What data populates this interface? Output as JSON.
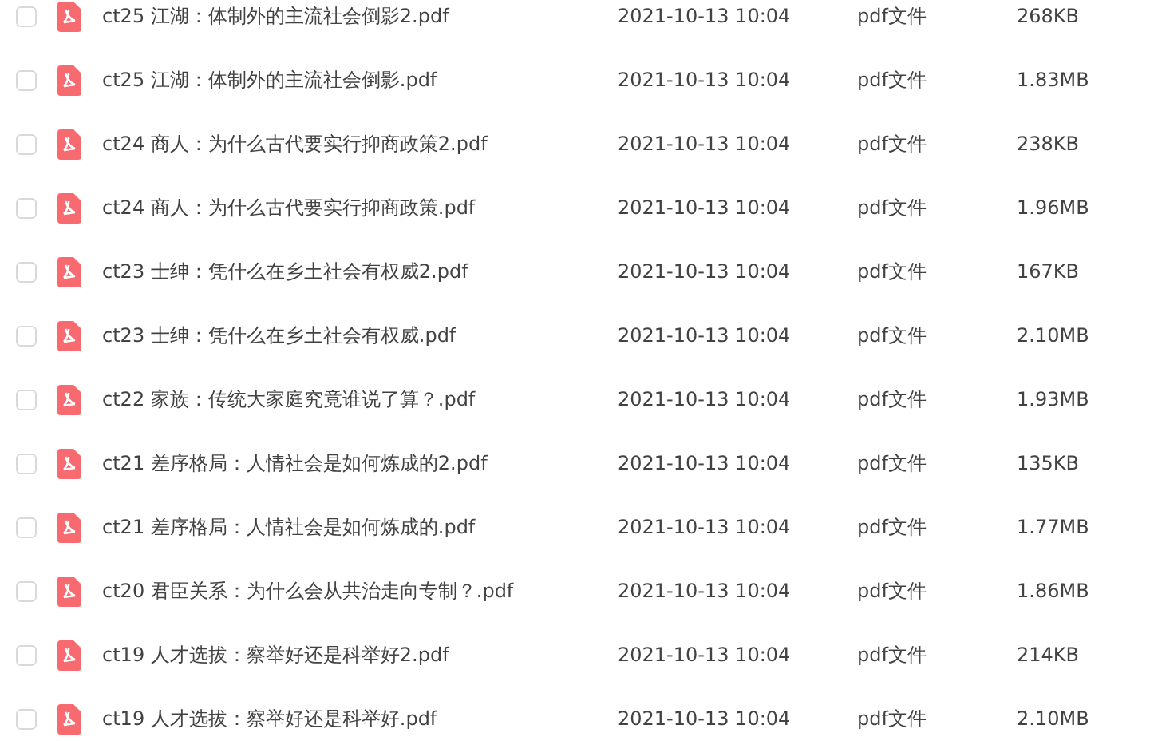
{
  "files": [
    {
      "checked": false,
      "code": "ct25",
      "title": "江湖：体制外的主流社会倒影2.pdf",
      "modified": "2021-10-13 10:04",
      "type": "pdf文件",
      "size": "268KB"
    },
    {
      "checked": false,
      "code": "ct25",
      "title": "江湖：体制外的主流社会倒影.pdf",
      "modified": "2021-10-13 10:04",
      "type": "pdf文件",
      "size": "1.83MB"
    },
    {
      "checked": false,
      "code": "ct24",
      "title": "商人：为什么古代要实行抑商政策2.pdf",
      "modified": "2021-10-13 10:04",
      "type": "pdf文件",
      "size": "238KB"
    },
    {
      "checked": false,
      "code": "ct24",
      "title": "商人：为什么古代要实行抑商政策.pdf",
      "modified": "2021-10-13 10:04",
      "type": "pdf文件",
      "size": "1.96MB"
    },
    {
      "checked": false,
      "code": "ct23",
      "title": "士绅：凭什么在乡土社会有权威2.pdf",
      "modified": "2021-10-13 10:04",
      "type": "pdf文件",
      "size": "167KB"
    },
    {
      "checked": false,
      "code": "ct23",
      "title": "士绅：凭什么在乡土社会有权威.pdf",
      "modified": "2021-10-13 10:04",
      "type": "pdf文件",
      "size": "2.10MB"
    },
    {
      "checked": false,
      "code": "ct22",
      "title": "家族：传统大家庭究竟谁说了算？.pdf",
      "modified": "2021-10-13 10:04",
      "type": "pdf文件",
      "size": "1.93MB"
    },
    {
      "checked": false,
      "code": "ct21",
      "title": "差序格局：人情社会是如何炼成的2.pdf",
      "modified": "2021-10-13 10:04",
      "type": "pdf文件",
      "size": "135KB"
    },
    {
      "checked": false,
      "code": "ct21",
      "title": "差序格局：人情社会是如何炼成的.pdf",
      "modified": "2021-10-13 10:04",
      "type": "pdf文件",
      "size": "1.77MB"
    },
    {
      "checked": false,
      "code": "ct20",
      "title": "君臣关系：为什么会从共治走向专制？.pdf",
      "modified": "2021-10-13 10:04",
      "type": "pdf文件",
      "size": "1.86MB"
    },
    {
      "checked": false,
      "code": "ct19",
      "title": "人才选拔：察举好还是科举好2.pdf",
      "modified": "2021-10-13 10:04",
      "type": "pdf文件",
      "size": "214KB"
    },
    {
      "checked": false,
      "code": "ct19",
      "title": "人才选拔：察举好还是科举好.pdf",
      "modified": "2021-10-13 10:04",
      "type": "pdf文件",
      "size": "2.10MB"
    }
  ]
}
